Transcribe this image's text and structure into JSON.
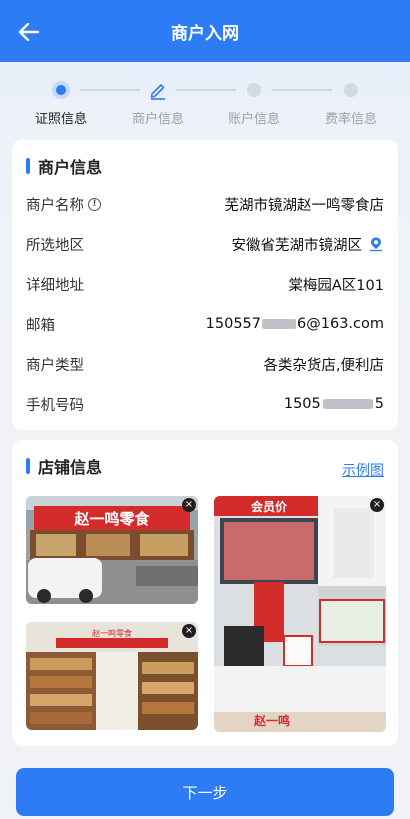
{
  "header": {
    "title": "商户入网"
  },
  "steps": [
    {
      "label": "证照信息",
      "state": "active"
    },
    {
      "label": "商户信息",
      "state": "edit"
    },
    {
      "label": "账户信息",
      "state": "pending"
    },
    {
      "label": "费率信息",
      "state": "pending"
    }
  ],
  "merchant": {
    "title": "商户信息",
    "rows": [
      {
        "key": "商户名称",
        "value": "芜湖市镜湖赵一鸣零食店"
      },
      {
        "key": "所选地区",
        "value": "安徽省芜湖市镜湖区"
      },
      {
        "key": "详细地址",
        "value": "棠梅园A区101"
      },
      {
        "key": "邮箱",
        "value_prefix": "150557",
        "value_suffix": "6@163.com"
      },
      {
        "key": "商户类型",
        "value": "各类杂货店,便利店"
      },
      {
        "key": "手机号码",
        "value_prefix": "1505",
        "value_suffix": "5"
      }
    ]
  },
  "store": {
    "title": "店铺信息",
    "sample_link": "示例图",
    "photos": [
      {
        "name": "storefront-photo",
        "sign_text": "赵一鸣零食"
      },
      {
        "name": "cashier-photo",
        "sign_text": "会员价"
      },
      {
        "name": "interior-photo",
        "sign_text": "赵一鸣零食"
      },
      {
        "name": "counter-photo",
        "sign_text": "赵一鸣"
      }
    ],
    "close_glyph": "×"
  },
  "footer": {
    "next_label": "下一步"
  },
  "colors": {
    "primary": "#2d7cf6",
    "brand_red": "#d42b2b"
  }
}
